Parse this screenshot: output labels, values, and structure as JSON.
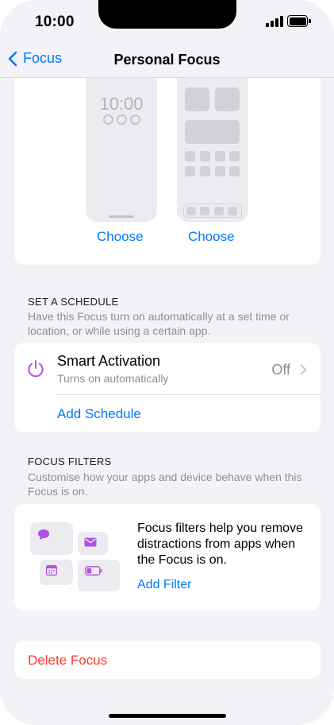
{
  "status_bar": {
    "time": "10:00"
  },
  "navbar": {
    "back_label": "Focus",
    "title": "Personal Focus"
  },
  "customise_screens": {
    "lock_screen_time": "10:00",
    "lock_choose_label": "Choose",
    "home_choose_label": "Choose"
  },
  "schedule": {
    "header": "SET A SCHEDULE",
    "description": "Have this Focus turn on automatically at a set time or location, or while using a certain app.",
    "smart_activation": {
      "title": "Smart Activation",
      "subtitle": "Turns on automatically",
      "value": "Off"
    },
    "add_schedule_label": "Add Schedule"
  },
  "filters": {
    "header": "FOCUS FILTERS",
    "description": "Customise how your apps and device behave when this Focus is on.",
    "body": "Focus filters help you remove distractions from apps when the Focus is on.",
    "add_filter_label": "Add Filter"
  },
  "delete_label": "Delete Focus",
  "colors": {
    "accent": "#007aff",
    "destructive": "#ff3b30",
    "focus_purple": "#af52de"
  }
}
